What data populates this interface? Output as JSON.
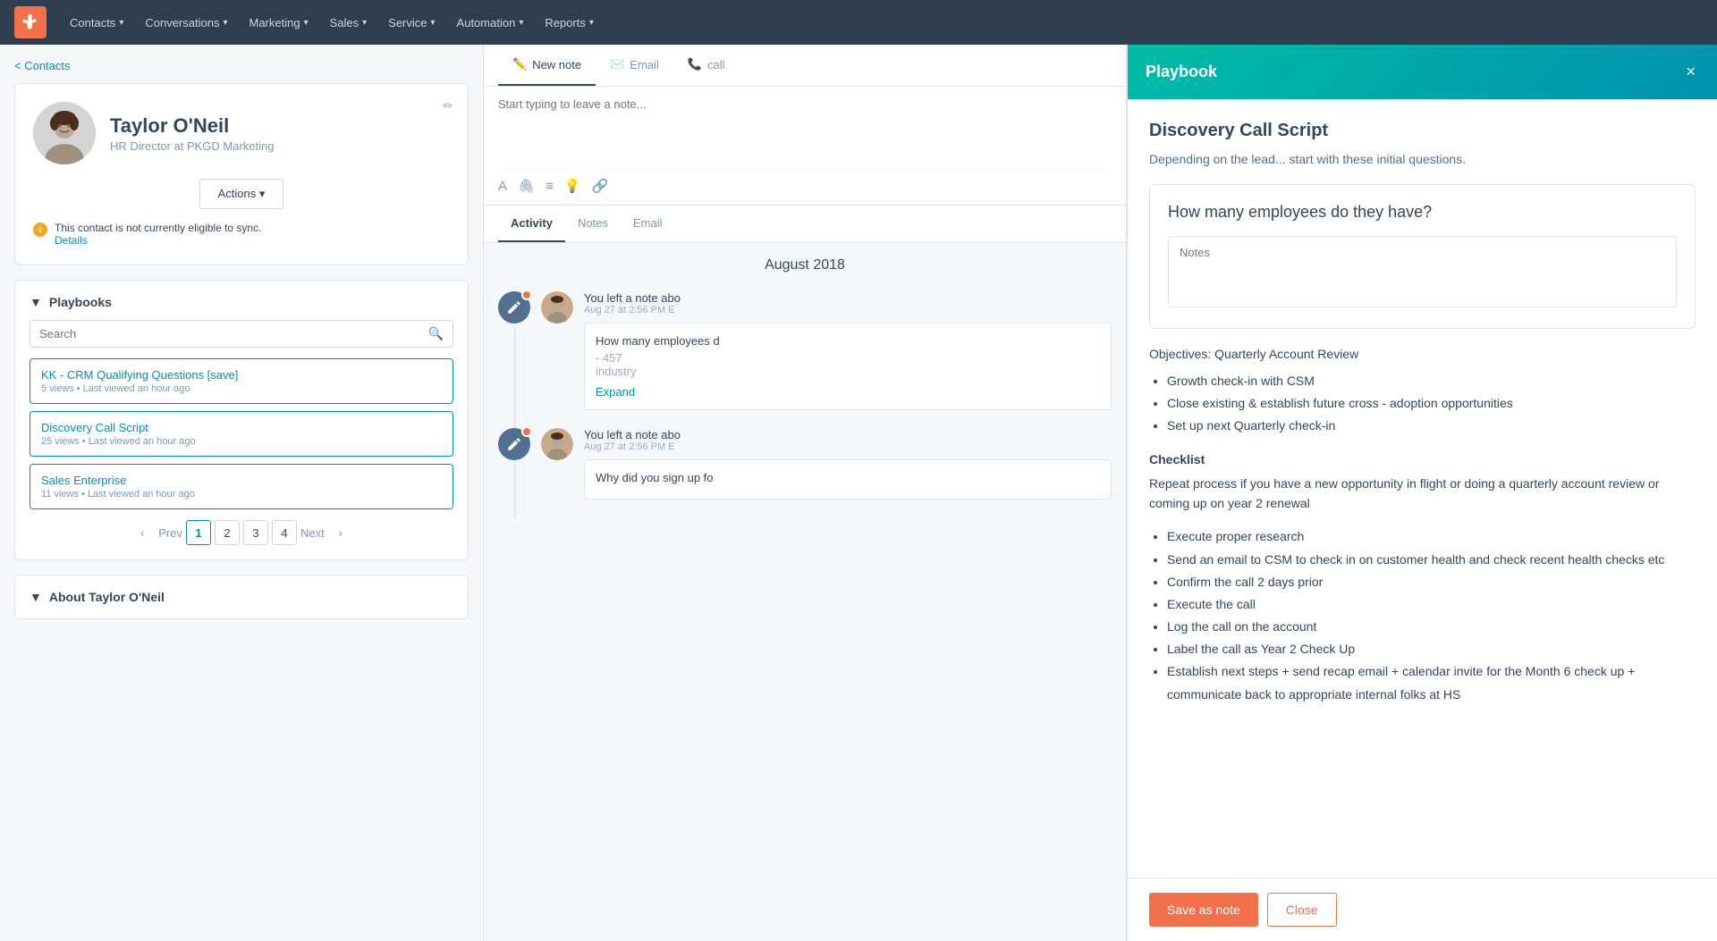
{
  "navbar": {
    "logo_label": "HubSpot",
    "items": [
      {
        "id": "contacts",
        "label": "Contacts",
        "has_dropdown": true
      },
      {
        "id": "conversations",
        "label": "Conversations",
        "has_dropdown": true
      },
      {
        "id": "marketing",
        "label": "Marketing",
        "has_dropdown": true
      },
      {
        "id": "sales",
        "label": "Sales",
        "has_dropdown": true
      },
      {
        "id": "service",
        "label": "Service",
        "has_dropdown": true
      },
      {
        "id": "automation",
        "label": "Automation",
        "has_dropdown": true
      },
      {
        "id": "reports",
        "label": "Reports",
        "has_dropdown": true
      }
    ]
  },
  "breadcrumb": {
    "label": "< Contacts"
  },
  "contact": {
    "name": "Taylor O'Neil",
    "title": "HR Director at PKGD Marketing",
    "actions_btn": "Actions ▾",
    "sync_warning": "This contact is not currently eligible to sync.",
    "details_link": "Details"
  },
  "playbooks_section": {
    "title": "Playbooks",
    "search_placeholder": "Search",
    "items": [
      {
        "title": "KK - CRM Qualifying Questions [save]",
        "meta": "5 views • Last viewed an hour ago"
      },
      {
        "title": "Discovery Call Script",
        "meta": "25 views • Last viewed an hour ago"
      },
      {
        "title": "Sales Enterprise",
        "meta": "11 views • Last viewed an hour ago"
      }
    ],
    "pagination": {
      "prev": "Prev",
      "next": "Next",
      "pages": [
        "1",
        "2",
        "3",
        "4"
      ],
      "active": "1"
    }
  },
  "about_section": {
    "title": "About Taylor O'Neil"
  },
  "notes_composer": {
    "tabs": [
      {
        "id": "new-note",
        "label": "New note",
        "icon": "✏️",
        "active": true
      },
      {
        "id": "email",
        "label": "Email",
        "icon": "✉️"
      },
      {
        "id": "call",
        "label": "C",
        "icon": "📞"
      }
    ],
    "placeholder": "Start typing to leave a note..."
  },
  "activity_tabs": {
    "tabs": [
      {
        "id": "activity",
        "label": "Activity",
        "active": true
      },
      {
        "id": "notes",
        "label": "Notes"
      },
      {
        "id": "email",
        "label": "Email"
      }
    ]
  },
  "activity_feed": {
    "month_label": "August 2018",
    "items": [
      {
        "type": "note",
        "title": "You left a note abo",
        "time": "Aug 27 at 2:56 PM E",
        "note_field": "How many employees d",
        "note_value": "- 457",
        "note_extra": "industry",
        "expand_label": "Expand"
      },
      {
        "type": "note",
        "title": "You left a note abo",
        "time": "Aug 27 at 2:56 PM E",
        "note_field": "Why did you sign up fo"
      }
    ]
  },
  "playbook_panel": {
    "header_title": "Playbook",
    "close_label": "×",
    "script_title": "Discovery Call Script",
    "description": "Depending on the lead... start with these initial questions.",
    "question": "How many employees do they have?",
    "notes_placeholder": "Notes",
    "objectives_label": "Objectives: Quarterly Account Review",
    "objectives_items": [
      "Growth check-in with CSM",
      "Close existing & establish future cross - adoption opportunities",
      "Set up next Quarterly check-in"
    ],
    "checklist_label": "Checklist",
    "repeat_text": "Repeat process if you have a new opportunity in flight or doing a quarterly account review or coming up on year 2 renewal",
    "checklist_items": [
      "Execute proper research",
      "Send an email to CSM to check in on customer health and check recent health checks etc",
      "Confirm the call 2 days prior",
      "Execute the call",
      "Log the call on the account",
      "Label the call as Year 2 Check Up",
      "Establish next steps + send recap email + calendar invite for the Month 6 check up + communicate back to appropriate internal folks at HS"
    ],
    "save_btn": "Save as note",
    "close_btn": "Close"
  }
}
